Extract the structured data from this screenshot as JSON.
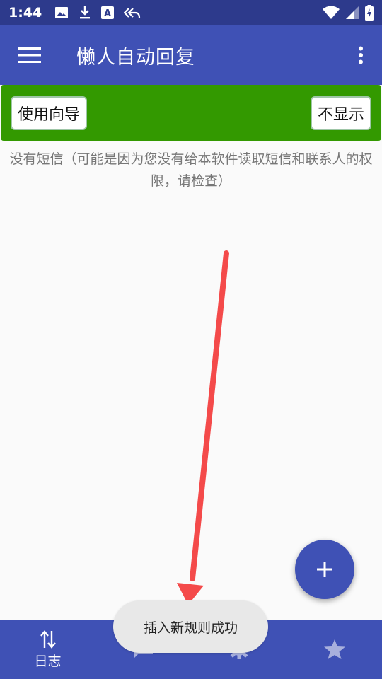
{
  "status_bar": {
    "time": "1:44",
    "icons": [
      "image-icon",
      "download-icon",
      "font-icon",
      "reply-all-icon",
      "wifi-icon",
      "signal-icon",
      "battery-icon"
    ]
  },
  "app_bar": {
    "title": "懒人自动回复",
    "color": "#3f51b5"
  },
  "guide_banner": {
    "guide_label": "使用向导",
    "hide_label": "不显示",
    "color": "#339900"
  },
  "main": {
    "empty_message": "没有短信（可能是因为您没有给本软件读取短信和联系人的权限，请检查）"
  },
  "bottom_nav": {
    "items": [
      {
        "label": "日志",
        "icon": "swap-vertical-icon",
        "active": true
      },
      {
        "label": "",
        "icon": "message-icon",
        "active": false
      },
      {
        "label": "",
        "icon": "settings-icon",
        "active": false
      },
      {
        "label": "",
        "icon": "star-icon",
        "active": false
      }
    ]
  },
  "toast": {
    "text": "插入新规则成功"
  },
  "annotation": {
    "color": "#f44a4a"
  }
}
